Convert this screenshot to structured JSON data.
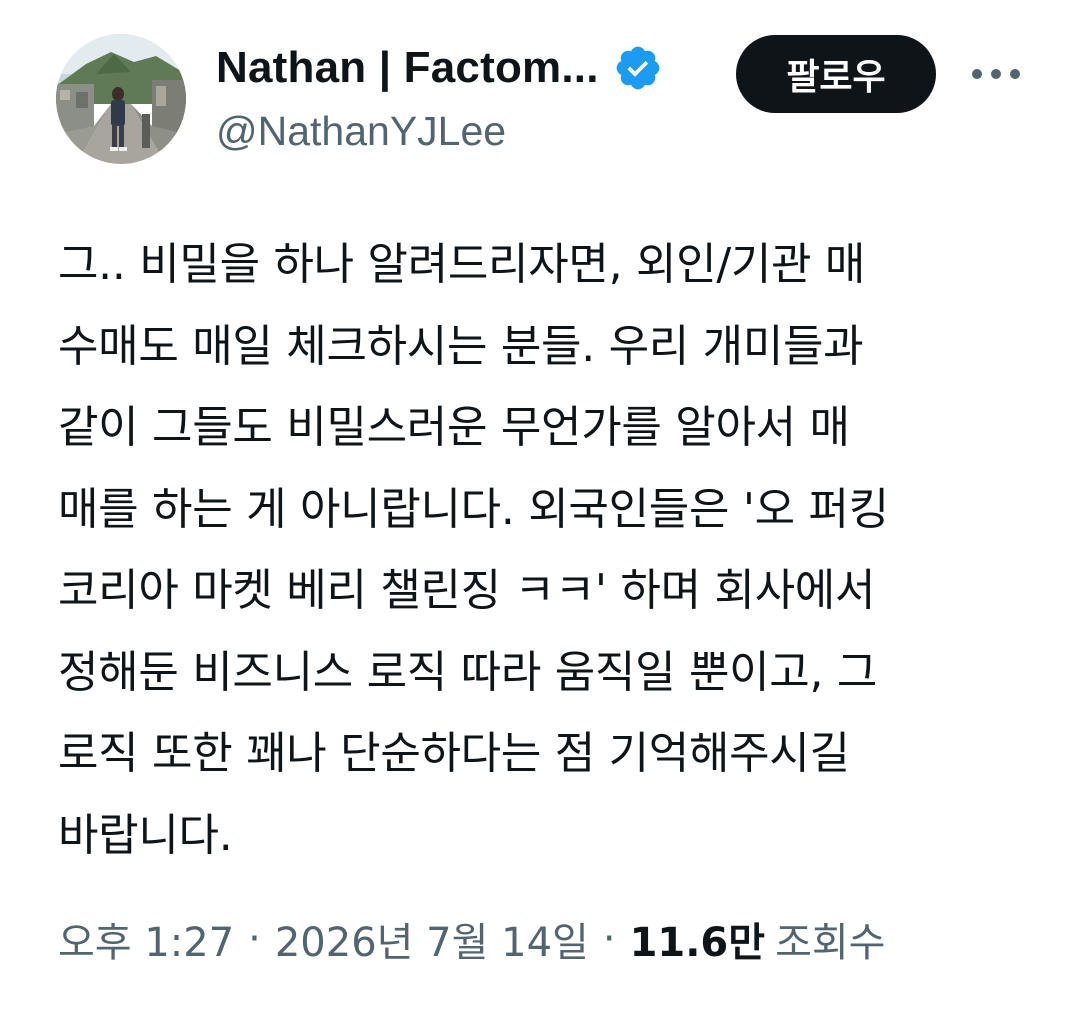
{
  "author": {
    "display_name": "Nathan | Factom...",
    "handle": "@NathanYJLee",
    "verified": true,
    "avatar_icon": "profile-photo"
  },
  "actions": {
    "follow_label": "팔로우",
    "more_icon": "ellipsis-icon"
  },
  "tweet": {
    "lines": [
      "그.. 비밀을 하나 알려드리자면, 외인/기관 매",
      "수매도 매일 체크하시는 분들. 우리 개미들과",
      "같이 그들도 비밀스러운 무언가를 알아서 매",
      "매를 하는 게 아니랍니다. 외국인들은 '오 퍼킹",
      "코리아 마켓 베리 챌린징 ㅋㅋ' 하며 회사에서",
      "정해둔 비즈니스 로직 따라 움직일 뿐이고, 그",
      "로직 또한 꽤나 단순하다는 점 기억해주시길",
      "바랍니다."
    ]
  },
  "meta": {
    "time": "오후 1:27",
    "separator": "·",
    "date": "2026년 7월 14일",
    "views_count": "11.6만",
    "views_label": "조회수"
  },
  "colors": {
    "text": "#0f1419",
    "secondary": "#536471",
    "verified_blue": "#1d9bf0",
    "button_bg": "#0f1419"
  }
}
